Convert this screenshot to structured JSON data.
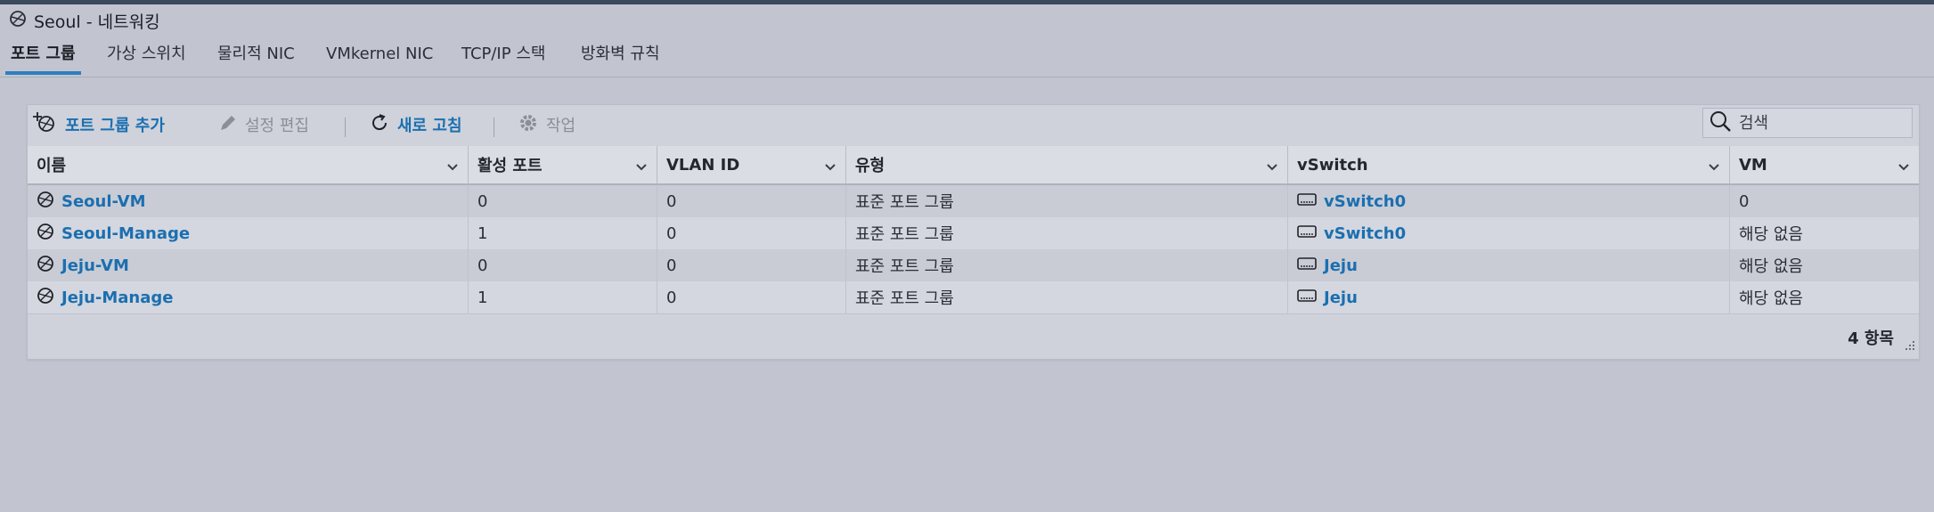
{
  "window": {
    "title": "Seoul - 네트워킹",
    "icon": "network-globe-icon"
  },
  "tabs": [
    {
      "label": "포트 그룹",
      "active": true
    },
    {
      "label": "가상 스위치",
      "active": false
    },
    {
      "label": "물리적 NIC",
      "active": false
    },
    {
      "label": "VMkernel NIC",
      "active": false
    },
    {
      "label": "TCP/IP 스택",
      "active": false
    },
    {
      "label": "방화벽 규칙",
      "active": false
    }
  ],
  "toolbar": {
    "add_label": "포트 그룹 추가",
    "edit_label": "설정 편집",
    "refresh_label": "새로 고침",
    "actions_label": "작업",
    "search_placeholder": "검색"
  },
  "table": {
    "headers": [
      "이름",
      "활성 포트",
      "VLAN ID",
      "유형",
      "vSwitch",
      "VM"
    ],
    "rows": [
      {
        "name": "Seoul-VM",
        "active_ports": "0",
        "vlan_id": "0",
        "type": "표준 포트 그룹",
        "vswitch": "vSwitch0",
        "vm": "0"
      },
      {
        "name": "Seoul-Manage",
        "active_ports": "1",
        "vlan_id": "0",
        "type": "표준 포트 그룹",
        "vswitch": "vSwitch0",
        "vm": "해당 없음"
      },
      {
        "name": "Jeju-VM",
        "active_ports": "0",
        "vlan_id": "0",
        "type": "표준 포트 그룹",
        "vswitch": "Jeju",
        "vm": "해당 없음"
      },
      {
        "name": "Jeju-Manage",
        "active_ports": "1",
        "vlan_id": "0",
        "type": "표준 포트 그룹",
        "vswitch": "Jeju",
        "vm": "해당 없음"
      }
    ],
    "footer_count": "4 항목"
  },
  "colors": {
    "accent": "#2d7fbf",
    "link": "#1b6fb0",
    "background": "#c2c5d0"
  }
}
